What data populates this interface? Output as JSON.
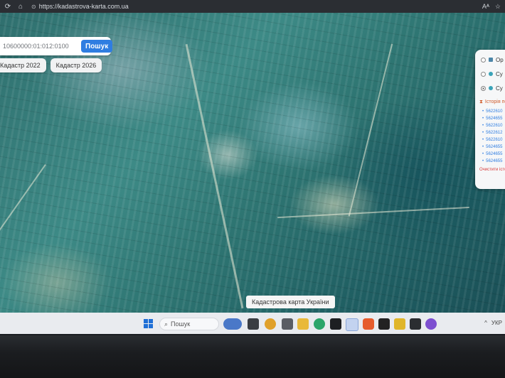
{
  "browser": {
    "url": "https://kadastrova-karta.com.ua",
    "extras": [
      "Aᴬ",
      "☆"
    ]
  },
  "search": {
    "value": "10600000:01:012:0100",
    "button_label": "Пошук"
  },
  "cadastre_tabs": [
    "Кадастр 2022",
    "Кадастр 2026"
  ],
  "layer_panel": {
    "layers": [
      {
        "label": "Ор",
        "selected": false
      },
      {
        "label": "Су",
        "selected": false
      },
      {
        "label": "Су",
        "selected": true
      }
    ],
    "history_title": "Історія по",
    "history_items": [
      "5622610",
      "5624655",
      "5622610",
      "5622612",
      "5622610",
      "5624655",
      "5624655",
      "5624655"
    ],
    "clear_label": "Очистити історі"
  },
  "attribution": "Кадастрова карта України",
  "taskbar": {
    "search_label": "Пошук",
    "tray_language": "УКР"
  },
  "colors": {
    "accent": "#2f7de1",
    "history_title": "#d05a2a",
    "clear_link": "#d63a3a"
  }
}
